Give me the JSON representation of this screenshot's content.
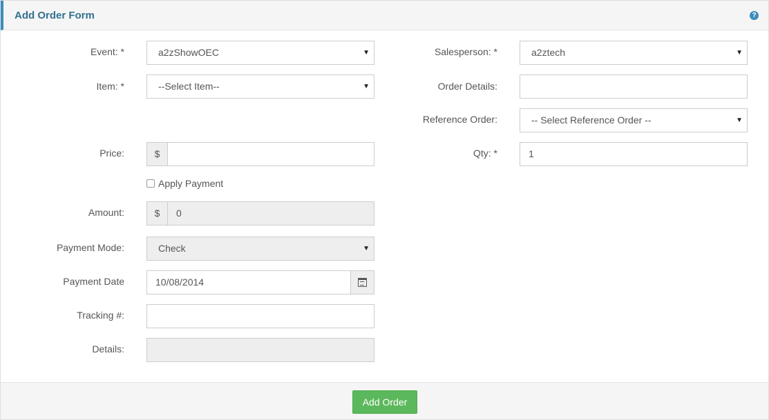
{
  "panel": {
    "title": "Add Order Form",
    "help_icon": "question-circle-icon"
  },
  "form": {
    "event": {
      "label": "Event: *",
      "value": "a2zShowOEC"
    },
    "item": {
      "label": "Item: *",
      "value": "--Select Item--"
    },
    "price": {
      "label": "Price:",
      "currency": "$",
      "value": ""
    },
    "apply_payment": {
      "label": "Apply Payment",
      "checked": false
    },
    "amount": {
      "label": "Amount:",
      "currency": "$",
      "value": "0"
    },
    "payment_mode": {
      "label": "Payment Mode:",
      "value": "Check"
    },
    "payment_date": {
      "label": "Payment Date",
      "value": "10/08/2014",
      "icon": "calendar-icon"
    },
    "tracking": {
      "label": "Tracking #:",
      "value": ""
    },
    "details": {
      "label": "Details:",
      "value": ""
    },
    "salesperson": {
      "label": "Salesperson: *",
      "value": "a2ztech"
    },
    "order_details": {
      "label": "Order Details:",
      "value": ""
    },
    "reference_order": {
      "label": "Reference Order:",
      "value": "-- Select Reference Order --"
    },
    "qty": {
      "label": "Qty: *",
      "value": "1"
    }
  },
  "footer": {
    "add_order_label": "Add Order"
  }
}
